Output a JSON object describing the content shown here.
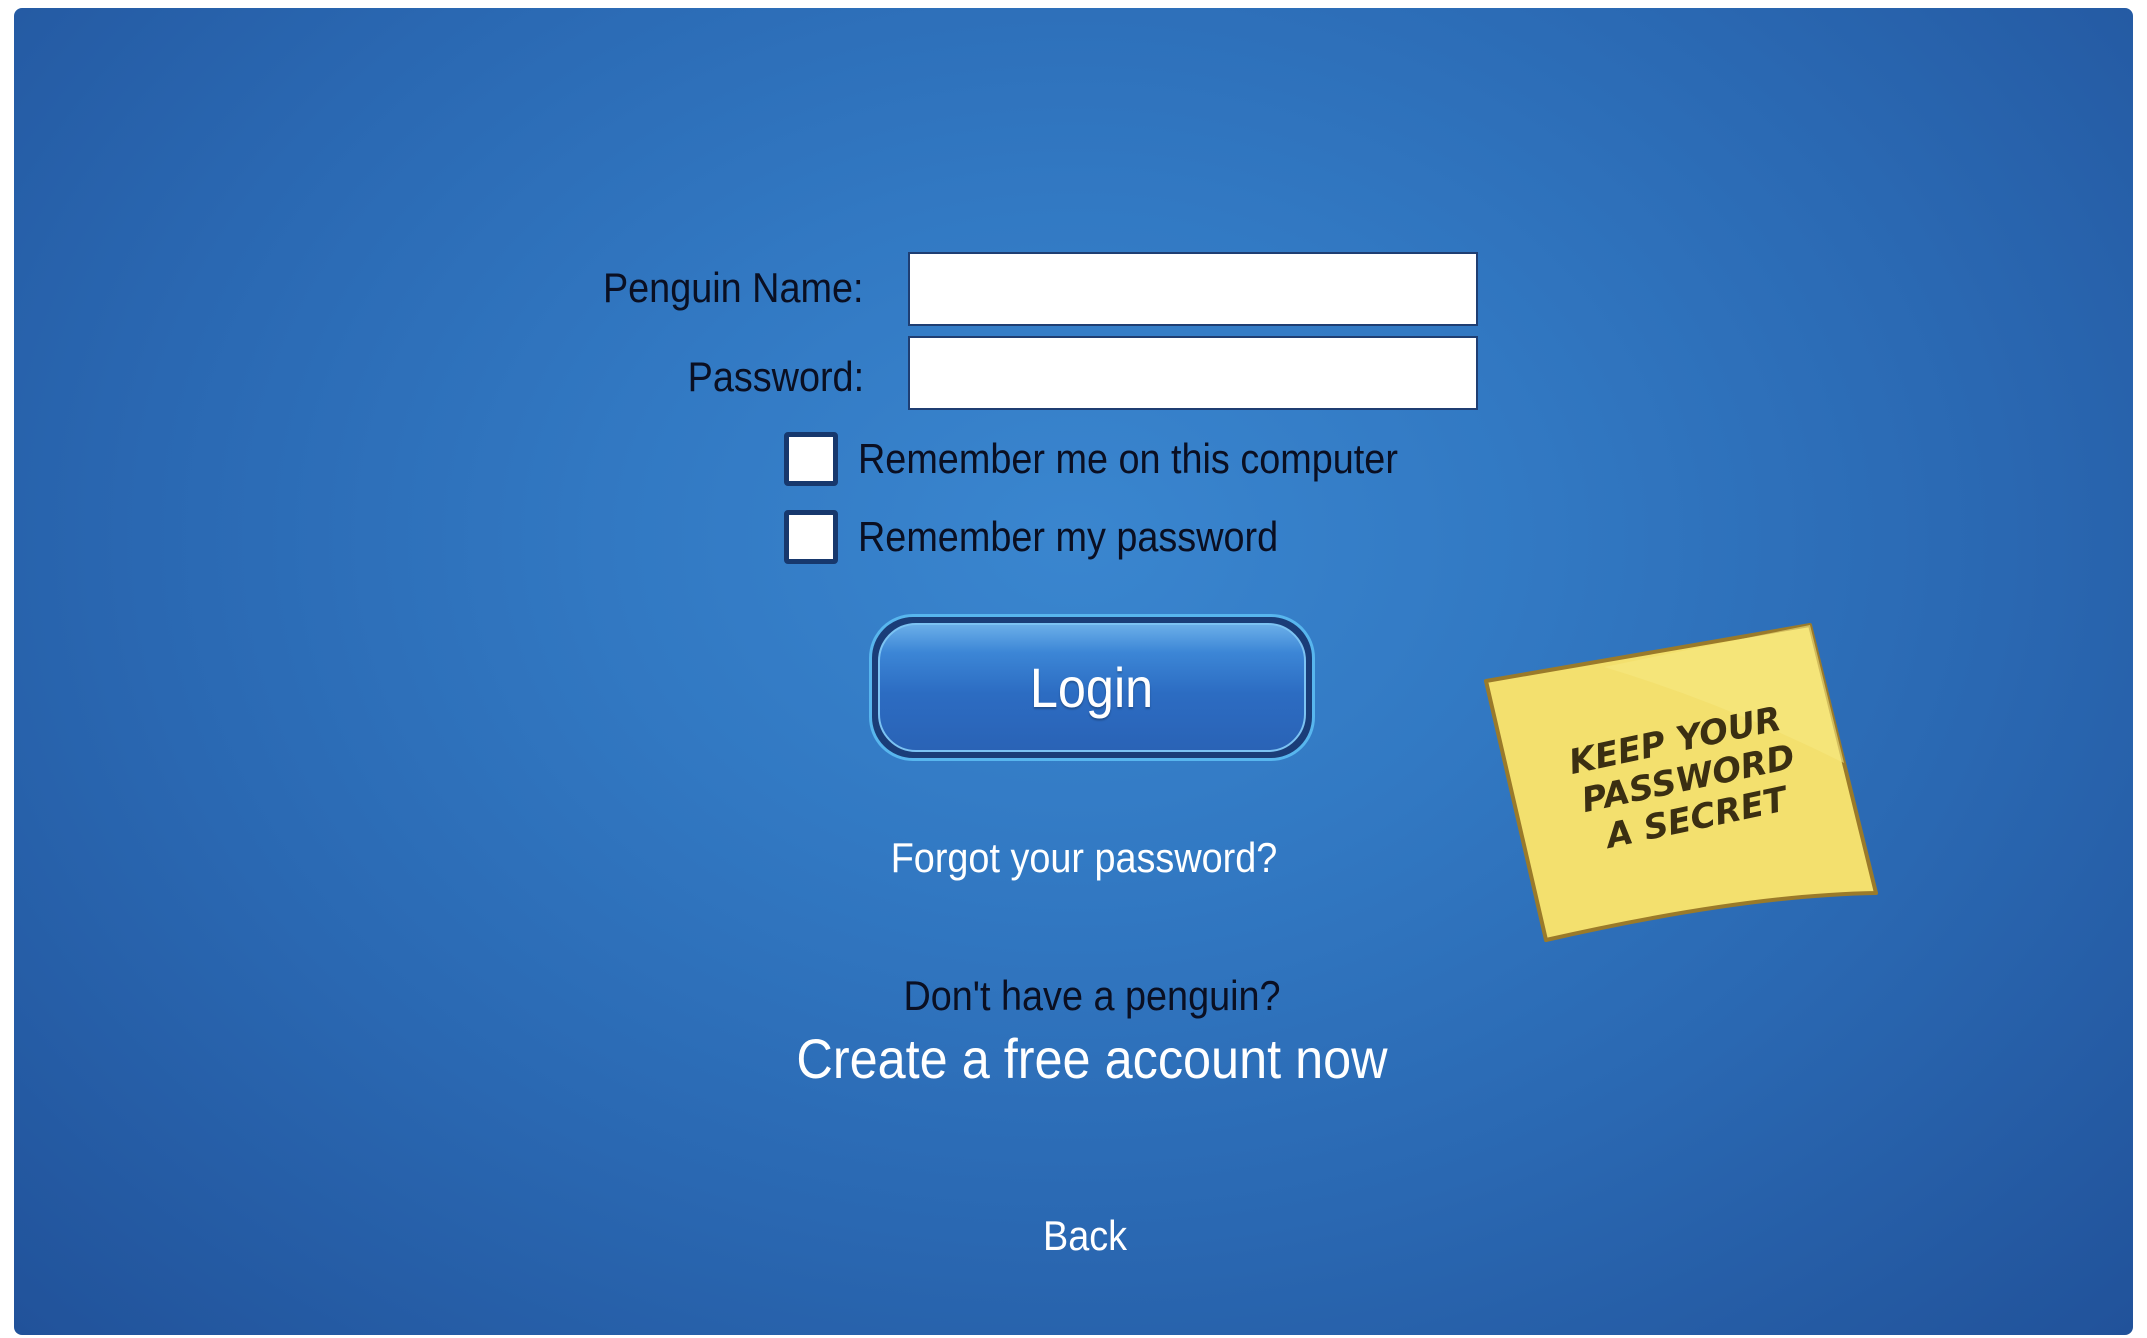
{
  "form": {
    "name_label": "Penguin Name:",
    "name_value": "",
    "password_label": "Password:",
    "password_value": "",
    "remember_me_label": "Remember me on this computer",
    "remember_password_label": "Remember my password",
    "remember_me_checked": false,
    "remember_password_checked": false
  },
  "login_button": {
    "label": "Login"
  },
  "links": {
    "forgot": "Forgot your password?",
    "no_penguin": "Don't have a penguin?",
    "create": "Create a free account now",
    "back": "Back"
  },
  "sticky_note": {
    "lines": [
      "KEEP YOUR",
      "PASSWORD",
      "A SECRET"
    ]
  },
  "colors": {
    "background": "#2f74c0",
    "note": "#f2df6a",
    "note_border": "#9a7a2a",
    "note_text": "#3b2f12"
  }
}
